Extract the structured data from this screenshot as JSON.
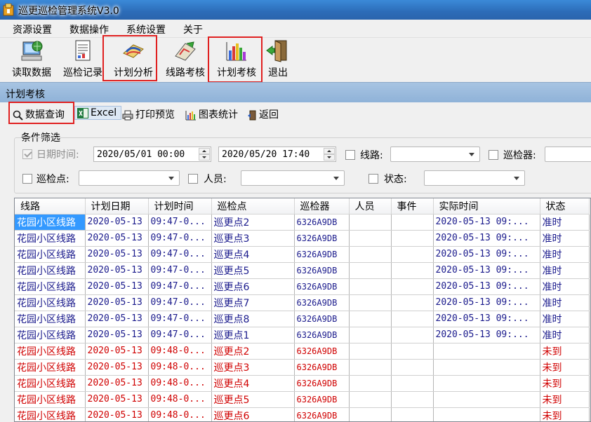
{
  "window": {
    "title": "巡更巡检管理系统V3.0"
  },
  "menu": [
    "资源设置",
    "数据操作",
    "系统设置",
    "关于"
  ],
  "toolbar": {
    "read": "读取数据",
    "records": "巡检记录",
    "plan_analysis": "计划分析",
    "route_check": "线路考核",
    "plan_check": "计划考核",
    "exit": "退出"
  },
  "child": {
    "title": "计划考核",
    "actions": {
      "query": "数据查询",
      "excel": "Excel",
      "print_preview": "打印预览",
      "chart_stats": "图表统计",
      "back": "返回"
    },
    "filters": {
      "group_label": "条件筛选",
      "date_label": "日期时间:",
      "date_from": "2020/05/01 00:00",
      "date_to": "2020/05/20 17:40",
      "route_label": "线路:",
      "device_label": "巡检器:",
      "point_label": "巡检点:",
      "person_label": "人员:",
      "status_label": "状态:"
    },
    "table": {
      "columns": [
        "线路",
        "计划日期",
        "计划时间",
        "巡检点",
        "巡检器",
        "人员",
        "事件",
        "实际时间",
        "状态"
      ],
      "rows": [
        [
          "花园小区线路",
          "2020-05-13",
          "09:47-0...",
          "巡更点2",
          "6326A9DB",
          "",
          "",
          "2020-05-13 09:...",
          "准时"
        ],
        [
          "花园小区线路",
          "2020-05-13",
          "09:47-0...",
          "巡更点3",
          "6326A9DB",
          "",
          "",
          "2020-05-13 09:...",
          "准时"
        ],
        [
          "花园小区线路",
          "2020-05-13",
          "09:47-0...",
          "巡更点4",
          "6326A9DB",
          "",
          "",
          "2020-05-13 09:...",
          "准时"
        ],
        [
          "花园小区线路",
          "2020-05-13",
          "09:47-0...",
          "巡更点5",
          "6326A9DB",
          "",
          "",
          "2020-05-13 09:...",
          "准时"
        ],
        [
          "花园小区线路",
          "2020-05-13",
          "09:47-0...",
          "巡更点6",
          "6326A9DB",
          "",
          "",
          "2020-05-13 09:...",
          "准时"
        ],
        [
          "花园小区线路",
          "2020-05-13",
          "09:47-0...",
          "巡更点7",
          "6326A9DB",
          "",
          "",
          "2020-05-13 09:...",
          "准时"
        ],
        [
          "花园小区线路",
          "2020-05-13",
          "09:47-0...",
          "巡更点8",
          "6326A9DB",
          "",
          "",
          "2020-05-13 09:...",
          "准时"
        ],
        [
          "花园小区线路",
          "2020-05-13",
          "09:47-0...",
          "巡更点1",
          "6326A9DB",
          "",
          "",
          "2020-05-13 09:...",
          "准时"
        ],
        [
          "花园小区线路",
          "2020-05-13",
          "09:48-0...",
          "巡更点2",
          "6326A9DB",
          "",
          "",
          "",
          "未到"
        ],
        [
          "花园小区线路",
          "2020-05-13",
          "09:48-0...",
          "巡更点3",
          "6326A9DB",
          "",
          "",
          "",
          "未到"
        ],
        [
          "花园小区线路",
          "2020-05-13",
          "09:48-0...",
          "巡更点4",
          "6326A9DB",
          "",
          "",
          "",
          "未到"
        ],
        [
          "花园小区线路",
          "2020-05-13",
          "09:48-0...",
          "巡更点5",
          "6326A9DB",
          "",
          "",
          "",
          "未到"
        ],
        [
          "花园小区线路",
          "2020-05-13",
          "09:48-0...",
          "巡更点6",
          "6326A9DB",
          "",
          "",
          "",
          "未到"
        ]
      ]
    }
  },
  "colors": {
    "on_time": "#1a1a8c",
    "missed": "#d00000",
    "highlight": "#e02020",
    "selection": "#3399ff"
  }
}
